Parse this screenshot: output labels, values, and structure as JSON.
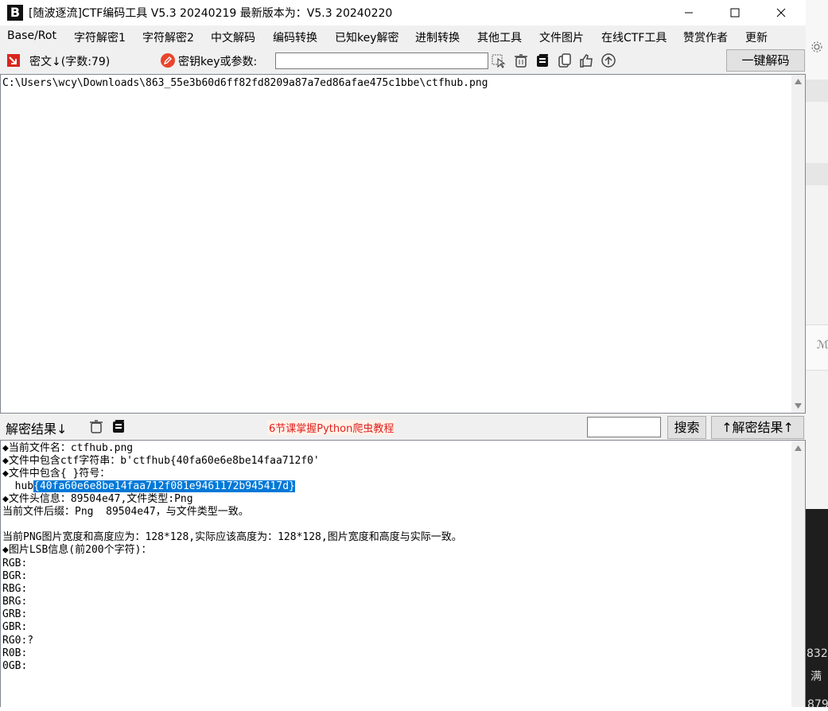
{
  "window": {
    "title": "[随波逐流]CTF编码工具 V5.3 20240219    最新版本为：V5.3 20240220",
    "logo_text": "B"
  },
  "menu": [
    "Base/Rot",
    "字符解密1",
    "字符解密2",
    "中文解码",
    "编码转换",
    "已知key解密",
    "进制转换",
    "其他工具",
    "文件图片",
    "在线CTF工具",
    "赞赏作者",
    "更新"
  ],
  "toolbar": {
    "cipher_label": "密文↓(字数:79)",
    "key_label": "密钥key或参数:",
    "key_value": "",
    "decode_button": "一键解码"
  },
  "input_pane": {
    "text": "C:\\Users\\wcy\\Downloads\\863_55e3b60d6ff82fd8209a87a7ed86afae475c1bbe\\ctfhub.png"
  },
  "midbar": {
    "result_label": "解密结果↓",
    "ad_text": "6节课掌握Python爬虫教程",
    "search_value": "",
    "search_button": "搜索",
    "up_button": "↑解密结果↑"
  },
  "output": {
    "lines": [
      "◆当前文件名：ctfhub.png",
      "◆文件中包含ctf字符串：b'ctfhub{40fa60e6e8be14faa712f0'",
      "◆文件中包含{ }符号：",
      "  hub"
    ],
    "selected_text": "{40fa60e6e8be14faa712f081e9461172b945417d}",
    "lines_after": [
      "◆文件头信息：89504e47,文件类型:Png",
      "当前文件后缀：Png  89504e47，与文件类型一致。",
      "",
      "当前PNG图片宽度和高度应为：128*128,实际应该高度为：128*128,图片宽度和高度与实际一致。",
      "◆图片LSB信息(前200个字符)：",
      "RGB:",
      "BGR:",
      "RBG:",
      "BRG:",
      "GRB:",
      "GBR:",
      "RG0:?",
      "R0B:",
      "0GB:"
    ]
  },
  "side": {
    "text1": "ℳ",
    "text2": "832",
    "text3": "满",
    "text4": "879"
  }
}
